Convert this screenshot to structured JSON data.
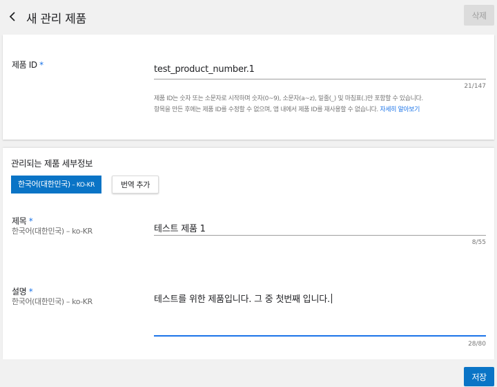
{
  "header": {
    "back_icon": "arrow-left-icon",
    "title": "새 관리 제품",
    "delete_label": "삭제"
  },
  "product_id": {
    "label": "제품 ID",
    "required_mark": "*",
    "value": "test_product_number.1",
    "counter": "21/147",
    "help_line1": "제품 ID는 숫자 또는 소문자로 시작하며 숫자(0~9), 소문자(a~z), 밑줄(_) 및 마침표(.)만 포함할 수 있습니다.",
    "help_line2": "항목을 만든 후에는 제품 ID를 수정할 수 없으며, 앱 내에서 제품 ID를 재사용할 수 없습니다.",
    "help_link": "자세히 알아보기"
  },
  "details": {
    "section_title": "관리되는 제품 세부정보",
    "language_button": "한국어(대한민국)",
    "language_code": " – KO-KR",
    "add_translation": "번역 추가",
    "title_field": {
      "label": "제목",
      "required_mark": "*",
      "sub_label": "한국어(대한민국) – ko-KR",
      "value": "테스트 제품 1",
      "counter": "8/55"
    },
    "description_field": {
      "label": "설명",
      "required_mark": "*",
      "sub_label": "한국어(대한민국) – ko-KR",
      "value": "테스트를 위한 제품입니다. 그 중 첫번째 입니다.",
      "counter": "28/80"
    }
  },
  "footer": {
    "save_label": "저장"
  },
  "colors": {
    "accent": "#0a74c6",
    "link": "#1a73e8",
    "background": "#f1f1f1"
  }
}
